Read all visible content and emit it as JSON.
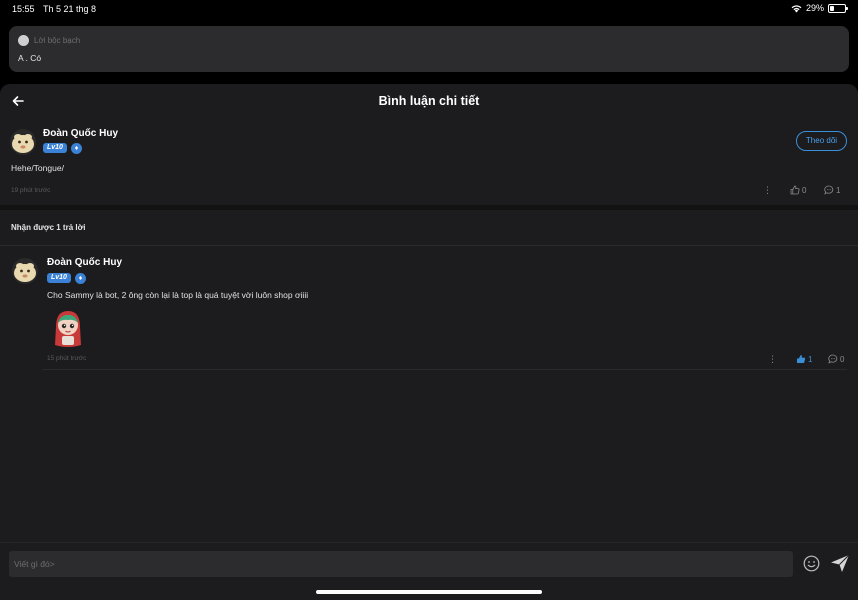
{
  "status": {
    "time": "15:55",
    "date": "Th 5 21 thg 8",
    "battery": "29%",
    "battery_level": 0.29
  },
  "prev_card": {
    "label": "Lời bộc bạch",
    "text": "A . Có"
  },
  "header": {
    "title": "Bình luận chi tiết"
  },
  "main_comment": {
    "author": "Đoàn Quốc Huy",
    "level": "Lv10",
    "follow_label": "Theo dõi",
    "text": "Hehe/Tongue/",
    "time": "19 phút trước",
    "like_count": "0",
    "reply_count": "1"
  },
  "replies": {
    "label": "Nhận được 1 trả lời",
    "items": [
      {
        "author": "Đoàn Quốc Huy",
        "level": "Lv10",
        "text": "Cho Sammy là bot, 2 ông còn lại là top là quá tuyệt vời luôn shop ơiiii",
        "time": "15 phút trước",
        "like_count": "1",
        "reply_count": "0",
        "liked": true
      }
    ]
  },
  "composer": {
    "placeholder": "Viết gì đó>"
  },
  "colors": {
    "accent": "#3a8fd9",
    "background": "#1c1c1e",
    "card": "#2c2c2e"
  },
  "icons": [
    "wifi-icon",
    "battery-icon",
    "back-arrow-icon",
    "verified-badge-icon",
    "more-icon",
    "thumbs-up-icon",
    "comment-icon",
    "emoji-icon",
    "send-icon"
  ]
}
